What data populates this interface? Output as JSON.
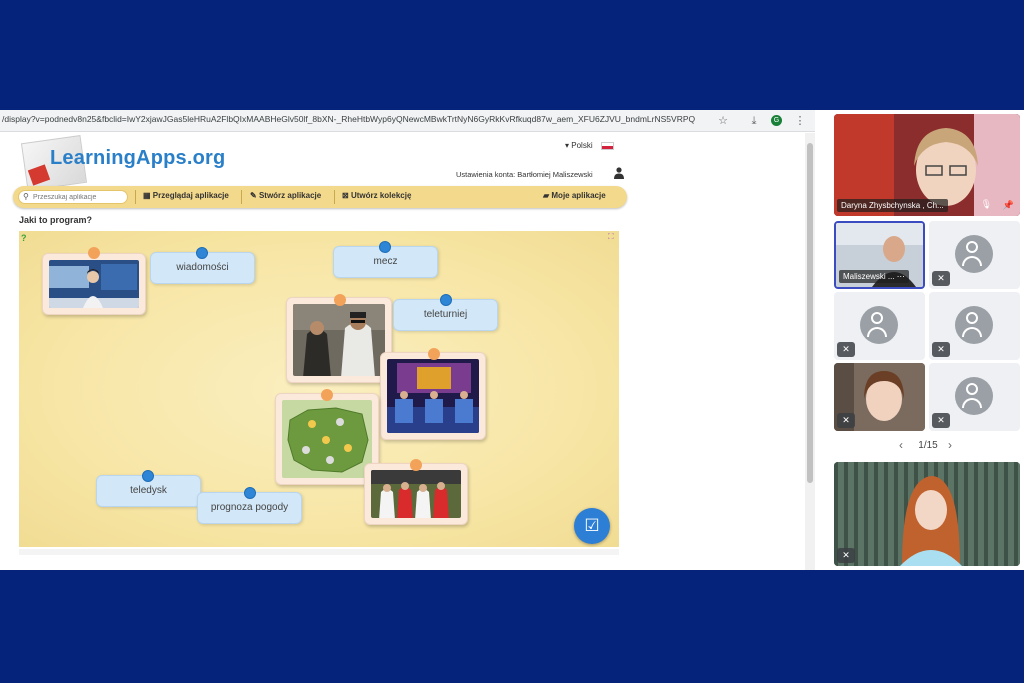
{
  "browser": {
    "url": "/display?v=podnedv8n25&fbclid=IwY2xjawJGas5leHRuA2FlbQIxMAABHeGlv50lf_8bXN-_RheHtbWyp6yQNewcMBwkTrtNyN6GyRkKvRfkuqd87w_aem_XFU6ZJVU_bndmLrNS5VRPQ",
    "icons": [
      "star-icon",
      "download-icon",
      "profile-icon",
      "more-icon"
    ],
    "profile_initial": "G"
  },
  "header": {
    "logo_text": "LearningApps.org",
    "language": "Polski",
    "account": "Ustawienia konta: Bartłomiej Maliszewski"
  },
  "nav": {
    "search_placeholder": "Przeszukaj aplikacje",
    "browse": "Przeglądaj aplikacje",
    "create": "Stwórz aplikacje",
    "collection": "Utwórz kolekcję",
    "my_apps": "Moje aplikacje"
  },
  "task": {
    "title": "Jaki to program?",
    "labels": [
      "wiadomości",
      "mecz",
      "teleturniej",
      "teledysk",
      "prognoza pogody"
    ]
  },
  "call": {
    "participants": [
      {
        "name": "Daryna Zhysbchynska , Ch..."
      },
      {
        "name": "Maliszewski ..."
      }
    ],
    "pager": "1/15"
  },
  "colors": {
    "frame": "#06237c",
    "board": "#f7e6a6",
    "label_bg": "#d2e7f7",
    "pin_blue": "#2f86d6",
    "pin_orange": "#f3a25a",
    "nav_bg": "#f3d98b",
    "check_button": "#2d7fd6"
  }
}
